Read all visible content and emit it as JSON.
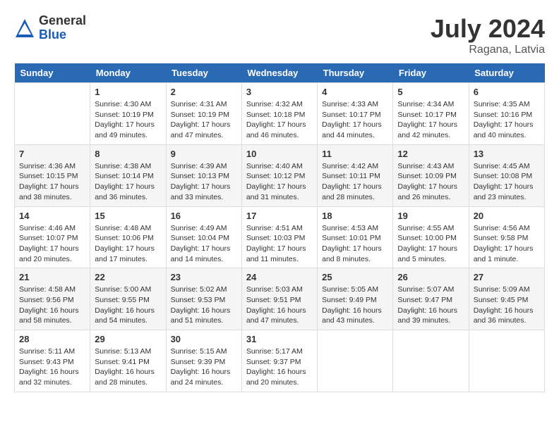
{
  "header": {
    "logo_general": "General",
    "logo_blue": "Blue",
    "month_year": "July 2024",
    "location": "Ragana, Latvia"
  },
  "days_of_week": [
    "Sunday",
    "Monday",
    "Tuesday",
    "Wednesday",
    "Thursday",
    "Friday",
    "Saturday"
  ],
  "weeks": [
    [
      {
        "day": "",
        "info": ""
      },
      {
        "day": "1",
        "info": "Sunrise: 4:30 AM\nSunset: 10:19 PM\nDaylight: 17 hours\nand 49 minutes."
      },
      {
        "day": "2",
        "info": "Sunrise: 4:31 AM\nSunset: 10:19 PM\nDaylight: 17 hours\nand 47 minutes."
      },
      {
        "day": "3",
        "info": "Sunrise: 4:32 AM\nSunset: 10:18 PM\nDaylight: 17 hours\nand 46 minutes."
      },
      {
        "day": "4",
        "info": "Sunrise: 4:33 AM\nSunset: 10:17 PM\nDaylight: 17 hours\nand 44 minutes."
      },
      {
        "day": "5",
        "info": "Sunrise: 4:34 AM\nSunset: 10:17 PM\nDaylight: 17 hours\nand 42 minutes."
      },
      {
        "day": "6",
        "info": "Sunrise: 4:35 AM\nSunset: 10:16 PM\nDaylight: 17 hours\nand 40 minutes."
      }
    ],
    [
      {
        "day": "7",
        "info": "Sunrise: 4:36 AM\nSunset: 10:15 PM\nDaylight: 17 hours\nand 38 minutes."
      },
      {
        "day": "8",
        "info": "Sunrise: 4:38 AM\nSunset: 10:14 PM\nDaylight: 17 hours\nand 36 minutes."
      },
      {
        "day": "9",
        "info": "Sunrise: 4:39 AM\nSunset: 10:13 PM\nDaylight: 17 hours\nand 33 minutes."
      },
      {
        "day": "10",
        "info": "Sunrise: 4:40 AM\nSunset: 10:12 PM\nDaylight: 17 hours\nand 31 minutes."
      },
      {
        "day": "11",
        "info": "Sunrise: 4:42 AM\nSunset: 10:11 PM\nDaylight: 17 hours\nand 28 minutes."
      },
      {
        "day": "12",
        "info": "Sunrise: 4:43 AM\nSunset: 10:09 PM\nDaylight: 17 hours\nand 26 minutes."
      },
      {
        "day": "13",
        "info": "Sunrise: 4:45 AM\nSunset: 10:08 PM\nDaylight: 17 hours\nand 23 minutes."
      }
    ],
    [
      {
        "day": "14",
        "info": "Sunrise: 4:46 AM\nSunset: 10:07 PM\nDaylight: 17 hours\nand 20 minutes."
      },
      {
        "day": "15",
        "info": "Sunrise: 4:48 AM\nSunset: 10:06 PM\nDaylight: 17 hours\nand 17 minutes."
      },
      {
        "day": "16",
        "info": "Sunrise: 4:49 AM\nSunset: 10:04 PM\nDaylight: 17 hours\nand 14 minutes."
      },
      {
        "day": "17",
        "info": "Sunrise: 4:51 AM\nSunset: 10:03 PM\nDaylight: 17 hours\nand 11 minutes."
      },
      {
        "day": "18",
        "info": "Sunrise: 4:53 AM\nSunset: 10:01 PM\nDaylight: 17 hours\nand 8 minutes."
      },
      {
        "day": "19",
        "info": "Sunrise: 4:55 AM\nSunset: 10:00 PM\nDaylight: 17 hours\nand 5 minutes."
      },
      {
        "day": "20",
        "info": "Sunrise: 4:56 AM\nSunset: 9:58 PM\nDaylight: 17 hours\nand 1 minute."
      }
    ],
    [
      {
        "day": "21",
        "info": "Sunrise: 4:58 AM\nSunset: 9:56 PM\nDaylight: 16 hours\nand 58 minutes."
      },
      {
        "day": "22",
        "info": "Sunrise: 5:00 AM\nSunset: 9:55 PM\nDaylight: 16 hours\nand 54 minutes."
      },
      {
        "day": "23",
        "info": "Sunrise: 5:02 AM\nSunset: 9:53 PM\nDaylight: 16 hours\nand 51 minutes."
      },
      {
        "day": "24",
        "info": "Sunrise: 5:03 AM\nSunset: 9:51 PM\nDaylight: 16 hours\nand 47 minutes."
      },
      {
        "day": "25",
        "info": "Sunrise: 5:05 AM\nSunset: 9:49 PM\nDaylight: 16 hours\nand 43 minutes."
      },
      {
        "day": "26",
        "info": "Sunrise: 5:07 AM\nSunset: 9:47 PM\nDaylight: 16 hours\nand 39 minutes."
      },
      {
        "day": "27",
        "info": "Sunrise: 5:09 AM\nSunset: 9:45 PM\nDaylight: 16 hours\nand 36 minutes."
      }
    ],
    [
      {
        "day": "28",
        "info": "Sunrise: 5:11 AM\nSunset: 9:43 PM\nDaylight: 16 hours\nand 32 minutes."
      },
      {
        "day": "29",
        "info": "Sunrise: 5:13 AM\nSunset: 9:41 PM\nDaylight: 16 hours\nand 28 minutes."
      },
      {
        "day": "30",
        "info": "Sunrise: 5:15 AM\nSunset: 9:39 PM\nDaylight: 16 hours\nand 24 minutes."
      },
      {
        "day": "31",
        "info": "Sunrise: 5:17 AM\nSunset: 9:37 PM\nDaylight: 16 hours\nand 20 minutes."
      },
      {
        "day": "",
        "info": ""
      },
      {
        "day": "",
        "info": ""
      },
      {
        "day": "",
        "info": ""
      }
    ]
  ]
}
